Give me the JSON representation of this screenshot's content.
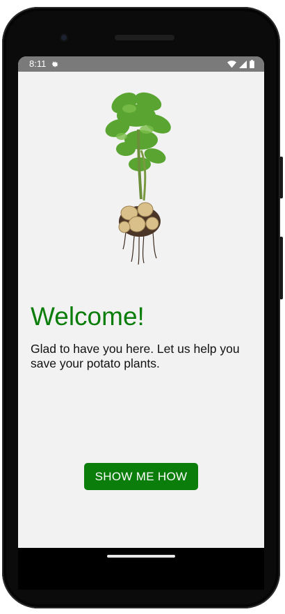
{
  "status_bar": {
    "time": "8:11",
    "settings_icon": "gear-icon",
    "wifi_icon": "wifi-icon",
    "signal_icon": "cell-signal-icon",
    "battery_icon": "battery-icon"
  },
  "hero": {
    "image": "potato-plant-illustration"
  },
  "welcome": {
    "title": "Welcome!",
    "subtitle": "Glad to have you here. Let us help you save your potato plants.",
    "title_color": "#0a7d0a"
  },
  "cta": {
    "label": "SHOW ME HOW",
    "background": "#0a7d0a"
  }
}
